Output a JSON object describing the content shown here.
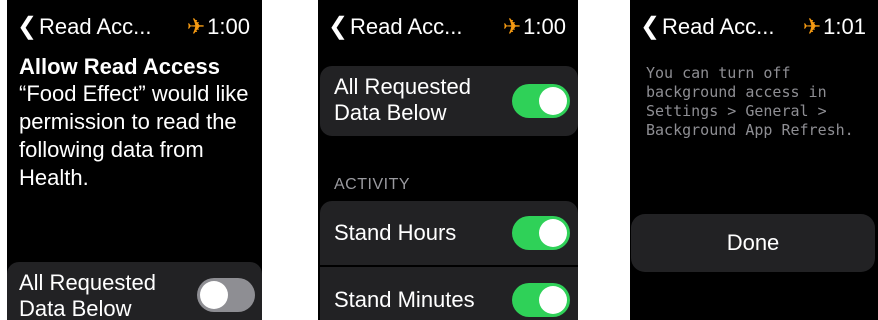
{
  "status_bar": {
    "back_label": "Read Acc...",
    "screen1_time": "1:00",
    "screen2_time": "1:00",
    "screen3_time": "1:01"
  },
  "screen1": {
    "title": "Allow Read Access",
    "message": "“Food Effect” would like permission to read the following data from Health.",
    "all_requested": "All Requested Data Below"
  },
  "screen2": {
    "all_requested": "All Requested Data Below",
    "section": "ACTIVITY",
    "items": [
      {
        "label": "Stand Hours",
        "enabled": true
      },
      {
        "label": "Stand Minutes",
        "enabled": true
      }
    ]
  },
  "screen3": {
    "info": "You can turn off background access in Settings > General > Background App Refresh.",
    "done_label": "Done"
  },
  "colors": {
    "accent_orange": "#f59a12",
    "toggle_on": "#2fd158",
    "toggle_off": "#8e8e93"
  }
}
